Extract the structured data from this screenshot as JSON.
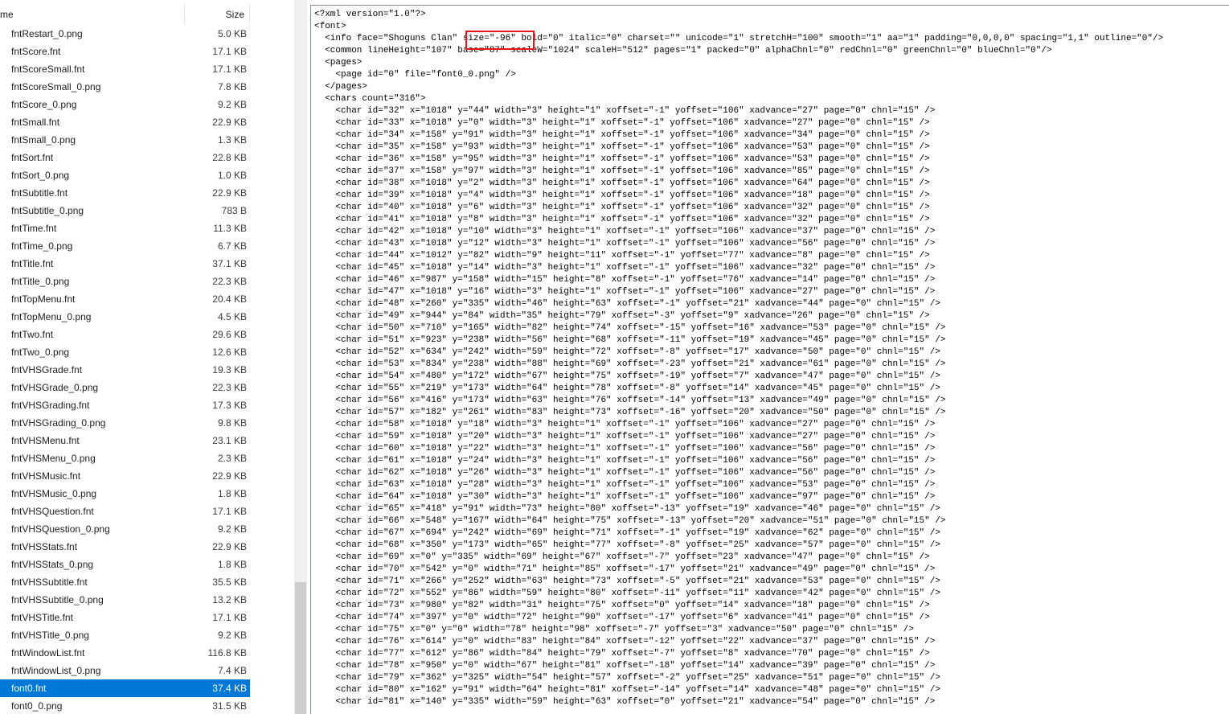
{
  "file_list": {
    "header": {
      "name_label": "me",
      "size_label": "Size"
    },
    "files": [
      {
        "name": "fntRestart_0.png",
        "size": "5.0 KB"
      },
      {
        "name": "fntScore.fnt",
        "size": "17.1 KB"
      },
      {
        "name": "fntScoreSmall.fnt",
        "size": "17.1 KB"
      },
      {
        "name": "fntScoreSmall_0.png",
        "size": "7.8 KB"
      },
      {
        "name": "fntScore_0.png",
        "size": "9.2 KB"
      },
      {
        "name": "fntSmall.fnt",
        "size": "22.9 KB"
      },
      {
        "name": "fntSmall_0.png",
        "size": "1.3 KB"
      },
      {
        "name": "fntSort.fnt",
        "size": "22.8 KB"
      },
      {
        "name": "fntSort_0.png",
        "size": "1.0 KB"
      },
      {
        "name": "fntSubtitle.fnt",
        "size": "22.9 KB"
      },
      {
        "name": "fntSubtitle_0.png",
        "size": "783 B"
      },
      {
        "name": "fntTime.fnt",
        "size": "11.3 KB"
      },
      {
        "name": "fntTime_0.png",
        "size": "6.7 KB"
      },
      {
        "name": "fntTitle.fnt",
        "size": "37.1 KB"
      },
      {
        "name": "fntTitle_0.png",
        "size": "22.3 KB"
      },
      {
        "name": "fntTopMenu.fnt",
        "size": "20.4 KB"
      },
      {
        "name": "fntTopMenu_0.png",
        "size": "4.5 KB"
      },
      {
        "name": "fntTwo.fnt",
        "size": "29.6 KB"
      },
      {
        "name": "fntTwo_0.png",
        "size": "12.6 KB"
      },
      {
        "name": "fntVHSGrade.fnt",
        "size": "19.3 KB"
      },
      {
        "name": "fntVHSGrade_0.png",
        "size": "22.3 KB"
      },
      {
        "name": "fntVHSGrading.fnt",
        "size": "17.3 KB"
      },
      {
        "name": "fntVHSGrading_0.png",
        "size": "9.8 KB"
      },
      {
        "name": "fntVHSMenu.fnt",
        "size": "23.1 KB"
      },
      {
        "name": "fntVHSMenu_0.png",
        "size": "2.3 KB"
      },
      {
        "name": "fntVHSMusic.fnt",
        "size": "22.9 KB"
      },
      {
        "name": "fntVHSMusic_0.png",
        "size": "1.8 KB"
      },
      {
        "name": "fntVHSQuestion.fnt",
        "size": "17.1 KB"
      },
      {
        "name": "fntVHSQuestion_0.png",
        "size": "9.2 KB"
      },
      {
        "name": "fntVHSStats.fnt",
        "size": "22.9 KB"
      },
      {
        "name": "fntVHSStats_0.png",
        "size": "1.8 KB"
      },
      {
        "name": "fntVHSSubtitle.fnt",
        "size": "35.5 KB"
      },
      {
        "name": "fntVHSSubtitle_0.png",
        "size": "13.2 KB"
      },
      {
        "name": "fntVHSTitle.fnt",
        "size": "17.1 KB"
      },
      {
        "name": "fntVHSTitle_0.png",
        "size": "9.2 KB"
      },
      {
        "name": "fntWindowList.fnt",
        "size": "116.8 KB"
      },
      {
        "name": "fntWindowList_0.png",
        "size": "7.4 KB"
      },
      {
        "name": "font0.fnt",
        "size": "37.4 KB",
        "selected": true
      },
      {
        "name": "font0_0.png",
        "size": "31.5 KB"
      }
    ]
  },
  "text_view": {
    "highlight_color": "#e8141c",
    "lines": [
      "<?xml version=\"1.0\"?>",
      "<font>",
      "  <info face=\"Shoguns Clan\" size=\"-96\" bold=\"0\" italic=\"0\" charset=\"\" unicode=\"1\" stretchH=\"100\" smooth=\"1\" aa=\"1\" padding=\"0,0,0,0\" spacing=\"1,1\" outline=\"0\"/>",
      "  <common lineHeight=\"107\" base=\"87\" scaleW=\"1024\" scaleH=\"512\" pages=\"1\" packed=\"0\" alphaChnl=\"0\" redChnl=\"0\" greenChnl=\"0\" blueChnl=\"0\"/>",
      "  <pages>",
      "    <page id=\"0\" file=\"font0_0.png\" />",
      "  </pages>",
      "  <chars count=\"316\">",
      "    <char id=\"32\" x=\"1018\" y=\"44\" width=\"3\" height=\"1\" xoffset=\"-1\" yoffset=\"106\" xadvance=\"27\" page=\"0\" chnl=\"15\" />",
      "    <char id=\"33\" x=\"1018\" y=\"0\" width=\"3\" height=\"1\" xoffset=\"-1\" yoffset=\"106\" xadvance=\"27\" page=\"0\" chnl=\"15\" />",
      "    <char id=\"34\" x=\"158\" y=\"91\" width=\"3\" height=\"1\" xoffset=\"-1\" yoffset=\"106\" xadvance=\"34\" page=\"0\" chnl=\"15\" />",
      "    <char id=\"35\" x=\"158\" y=\"93\" width=\"3\" height=\"1\" xoffset=\"-1\" yoffset=\"106\" xadvance=\"53\" page=\"0\" chnl=\"15\" />",
      "    <char id=\"36\" x=\"158\" y=\"95\" width=\"3\" height=\"1\" xoffset=\"-1\" yoffset=\"106\" xadvance=\"53\" page=\"0\" chnl=\"15\" />",
      "    <char id=\"37\" x=\"158\" y=\"97\" width=\"3\" height=\"1\" xoffset=\"-1\" yoffset=\"106\" xadvance=\"85\" page=\"0\" chnl=\"15\" />",
      "    <char id=\"38\" x=\"1018\" y=\"2\" width=\"3\" height=\"1\" xoffset=\"-1\" yoffset=\"106\" xadvance=\"64\" page=\"0\" chnl=\"15\" />",
      "    <char id=\"39\" x=\"1018\" y=\"4\" width=\"3\" height=\"1\" xoffset=\"-1\" yoffset=\"106\" xadvance=\"18\" page=\"0\" chnl=\"15\" />",
      "    <char id=\"40\" x=\"1018\" y=\"6\" width=\"3\" height=\"1\" xoffset=\"-1\" yoffset=\"106\" xadvance=\"32\" page=\"0\" chnl=\"15\" />",
      "    <char id=\"41\" x=\"1018\" y=\"8\" width=\"3\" height=\"1\" xoffset=\"-1\" yoffset=\"106\" xadvance=\"32\" page=\"0\" chnl=\"15\" />",
      "    <char id=\"42\" x=\"1018\" y=\"10\" width=\"3\" height=\"1\" xoffset=\"-1\" yoffset=\"106\" xadvance=\"37\" page=\"0\" chnl=\"15\" />",
      "    <char id=\"43\" x=\"1018\" y=\"12\" width=\"3\" height=\"1\" xoffset=\"-1\" yoffset=\"106\" xadvance=\"56\" page=\"0\" chnl=\"15\" />",
      "    <char id=\"44\" x=\"1012\" y=\"82\" width=\"9\" height=\"11\" xoffset=\"-1\" yoffset=\"77\" xadvance=\"8\" page=\"0\" chnl=\"15\" />",
      "    <char id=\"45\" x=\"1018\" y=\"14\" width=\"3\" height=\"1\" xoffset=\"-1\" yoffset=\"106\" xadvance=\"32\" page=\"0\" chnl=\"15\" />",
      "    <char id=\"46\" x=\"987\" y=\"158\" width=\"15\" height=\"8\" xoffset=\"-1\" yoffset=\"76\" xadvance=\"14\" page=\"0\" chnl=\"15\" />",
      "    <char id=\"47\" x=\"1018\" y=\"16\" width=\"3\" height=\"1\" xoffset=\"-1\" yoffset=\"106\" xadvance=\"27\" page=\"0\" chnl=\"15\" />",
      "    <char id=\"48\" x=\"260\" y=\"335\" width=\"46\" height=\"63\" xoffset=\"-1\" yoffset=\"21\" xadvance=\"44\" page=\"0\" chnl=\"15\" />",
      "    <char id=\"49\" x=\"944\" y=\"84\" width=\"35\" height=\"79\" xoffset=\"-3\" yoffset=\"9\" xadvance=\"26\" page=\"0\" chnl=\"15\" />",
      "    <char id=\"50\" x=\"710\" y=\"165\" width=\"82\" height=\"74\" xoffset=\"-15\" yoffset=\"16\" xadvance=\"53\" page=\"0\" chnl=\"15\" />",
      "    <char id=\"51\" x=\"923\" y=\"238\" width=\"56\" height=\"68\" xoffset=\"-11\" yoffset=\"19\" xadvance=\"45\" page=\"0\" chnl=\"15\" />",
      "    <char id=\"52\" x=\"634\" y=\"242\" width=\"59\" height=\"72\" xoffset=\"-8\" yoffset=\"17\" xadvance=\"50\" page=\"0\" chnl=\"15\" />",
      "    <char id=\"53\" x=\"834\" y=\"238\" width=\"88\" height=\"69\" xoffset=\"-23\" yoffset=\"21\" xadvance=\"61\" page=\"0\" chnl=\"15\" />",
      "    <char id=\"54\" x=\"480\" y=\"172\" width=\"67\" height=\"75\" xoffset=\"-19\" yoffset=\"7\" xadvance=\"47\" page=\"0\" chnl=\"15\" />",
      "    <char id=\"55\" x=\"219\" y=\"173\" width=\"64\" height=\"78\" xoffset=\"-8\" yoffset=\"14\" xadvance=\"45\" page=\"0\" chnl=\"15\" />",
      "    <char id=\"56\" x=\"416\" y=\"173\" width=\"63\" height=\"76\" xoffset=\"-14\" yoffset=\"13\" xadvance=\"49\" page=\"0\" chnl=\"15\" />",
      "    <char id=\"57\" x=\"182\" y=\"261\" width=\"83\" height=\"73\" xoffset=\"-16\" yoffset=\"20\" xadvance=\"50\" page=\"0\" chnl=\"15\" />",
      "    <char id=\"58\" x=\"1018\" y=\"18\" width=\"3\" height=\"1\" xoffset=\"-1\" yoffset=\"106\" xadvance=\"27\" page=\"0\" chnl=\"15\" />",
      "    <char id=\"59\" x=\"1018\" y=\"20\" width=\"3\" height=\"1\" xoffset=\"-1\" yoffset=\"106\" xadvance=\"27\" page=\"0\" chnl=\"15\" />",
      "    <char id=\"60\" x=\"1018\" y=\"22\" width=\"3\" height=\"1\" xoffset=\"-1\" yoffset=\"106\" xadvance=\"56\" page=\"0\" chnl=\"15\" />",
      "    <char id=\"61\" x=\"1018\" y=\"24\" width=\"3\" height=\"1\" xoffset=\"-1\" yoffset=\"106\" xadvance=\"56\" page=\"0\" chnl=\"15\" />",
      "    <char id=\"62\" x=\"1018\" y=\"26\" width=\"3\" height=\"1\" xoffset=\"-1\" yoffset=\"106\" xadvance=\"56\" page=\"0\" chnl=\"15\" />",
      "    <char id=\"63\" x=\"1018\" y=\"28\" width=\"3\" height=\"1\" xoffset=\"-1\" yoffset=\"106\" xadvance=\"53\" page=\"0\" chnl=\"15\" />",
      "    <char id=\"64\" x=\"1018\" y=\"30\" width=\"3\" height=\"1\" xoffset=\"-1\" yoffset=\"106\" xadvance=\"97\" page=\"0\" chnl=\"15\" />",
      "    <char id=\"65\" x=\"418\" y=\"91\" width=\"73\" height=\"80\" xoffset=\"-13\" yoffset=\"19\" xadvance=\"46\" page=\"0\" chnl=\"15\" />",
      "    <char id=\"66\" x=\"548\" y=\"167\" width=\"64\" height=\"75\" xoffset=\"-13\" yoffset=\"20\" xadvance=\"51\" page=\"0\" chnl=\"15\" />",
      "    <char id=\"67\" x=\"694\" y=\"242\" width=\"69\" height=\"71\" xoffset=\"-1\" yoffset=\"19\" xadvance=\"62\" page=\"0\" chnl=\"15\" />",
      "    <char id=\"68\" x=\"350\" y=\"173\" width=\"65\" height=\"77\" xoffset=\"-8\" yoffset=\"25\" xadvance=\"57\" page=\"0\" chnl=\"15\" />",
      "    <char id=\"69\" x=\"0\" y=\"335\" width=\"69\" height=\"67\" xoffset=\"-7\" yoffset=\"23\" xadvance=\"47\" page=\"0\" chnl=\"15\" />",
      "    <char id=\"70\" x=\"542\" y=\"0\" width=\"71\" height=\"85\" xoffset=\"-17\" yoffset=\"21\" xadvance=\"49\" page=\"0\" chnl=\"15\" />",
      "    <char id=\"71\" x=\"266\" y=\"252\" width=\"63\" height=\"73\" xoffset=\"-5\" yoffset=\"21\" xadvance=\"53\" page=\"0\" chnl=\"15\" />",
      "    <char id=\"72\" x=\"552\" y=\"86\" width=\"59\" height=\"80\" xoffset=\"-11\" yoffset=\"11\" xadvance=\"42\" page=\"0\" chnl=\"15\" />",
      "    <char id=\"73\" x=\"980\" y=\"82\" width=\"31\" height=\"75\" xoffset=\"0\" yoffset=\"14\" xadvance=\"18\" page=\"0\" chnl=\"15\" />",
      "    <char id=\"74\" x=\"397\" y=\"0\" width=\"72\" height=\"90\" xoffset=\"-17\" yoffset=\"6\" xadvance=\"41\" page=\"0\" chnl=\"15\" />",
      "    <char id=\"75\" x=\"0\" y=\"0\" width=\"78\" height=\"98\" xoffset=\"-7\" yoffset=\"3\" xadvance=\"50\" page=\"0\" chnl=\"15\" />",
      "    <char id=\"76\" x=\"614\" y=\"0\" width=\"83\" height=\"84\" xoffset=\"-12\" yoffset=\"22\" xadvance=\"37\" page=\"0\" chnl=\"15\" />",
      "    <char id=\"77\" x=\"612\" y=\"86\" width=\"84\" height=\"79\" xoffset=\"-7\" yoffset=\"8\" xadvance=\"70\" page=\"0\" chnl=\"15\" />",
      "    <char id=\"78\" x=\"950\" y=\"0\" width=\"67\" height=\"81\" xoffset=\"-18\" yoffset=\"14\" xadvance=\"39\" page=\"0\" chnl=\"15\" />",
      "    <char id=\"79\" x=\"362\" y=\"325\" width=\"54\" height=\"57\" xoffset=\"-2\" yoffset=\"25\" xadvance=\"51\" page=\"0\" chnl=\"15\" />",
      "    <char id=\"80\" x=\"162\" y=\"91\" width=\"64\" height=\"81\" xoffset=\"-14\" yoffset=\"14\" xadvance=\"48\" page=\"0\" chnl=\"15\" />",
      "    <char id=\"81\" x=\"140\" y=\"335\" width=\"59\" height=\"63\" xoffset=\"0\" yoffset=\"21\" xadvance=\"54\" page=\"0\" chnl=\"15\" />"
    ]
  }
}
